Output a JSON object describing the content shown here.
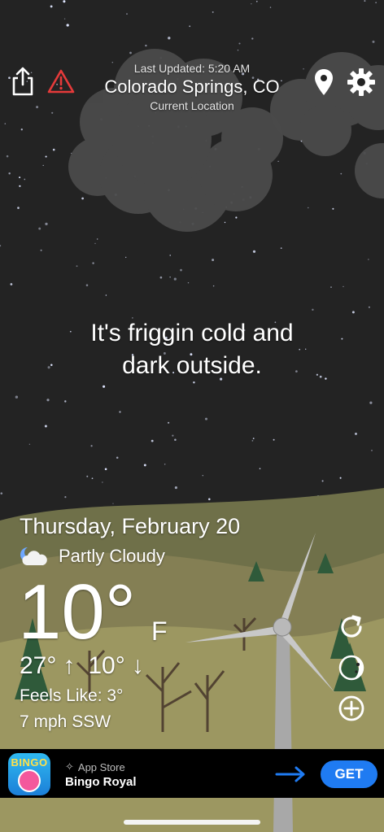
{
  "header": {
    "last_updated": "Last Updated: 5:20 AM",
    "location": "Colorado Springs, CO",
    "location_sub": "Current Location"
  },
  "message": {
    "line1": "It's friggin cold and",
    "line2": "dark outside."
  },
  "weather": {
    "date": "Thursday, February 20",
    "condition": "Partly Cloudy",
    "temperature": "10°",
    "unit": "F",
    "high": "27°",
    "low": "10°",
    "feels_like": "Feels Like: 3°",
    "wind": "7 mph SSW"
  },
  "ad": {
    "store_label": "App Store",
    "app_name": "Bingo Royal",
    "get_label": "GET",
    "app_icon_text": "BINGO"
  },
  "icons": {
    "share": "share-icon",
    "alert": "warning-icon",
    "location": "location-pin-icon",
    "settings": "gear-icon",
    "refresh": "refresh-icon",
    "moon": "moon-phase-icon",
    "add": "add-circle-icon"
  },
  "colors": {
    "sky": "#232323",
    "hill_front": "#9c9761",
    "hill_back": "#6f7049",
    "alert": "#e53a3a",
    "get_button": "#1f7bf2",
    "ad_arrow": "#1f7bf2"
  }
}
